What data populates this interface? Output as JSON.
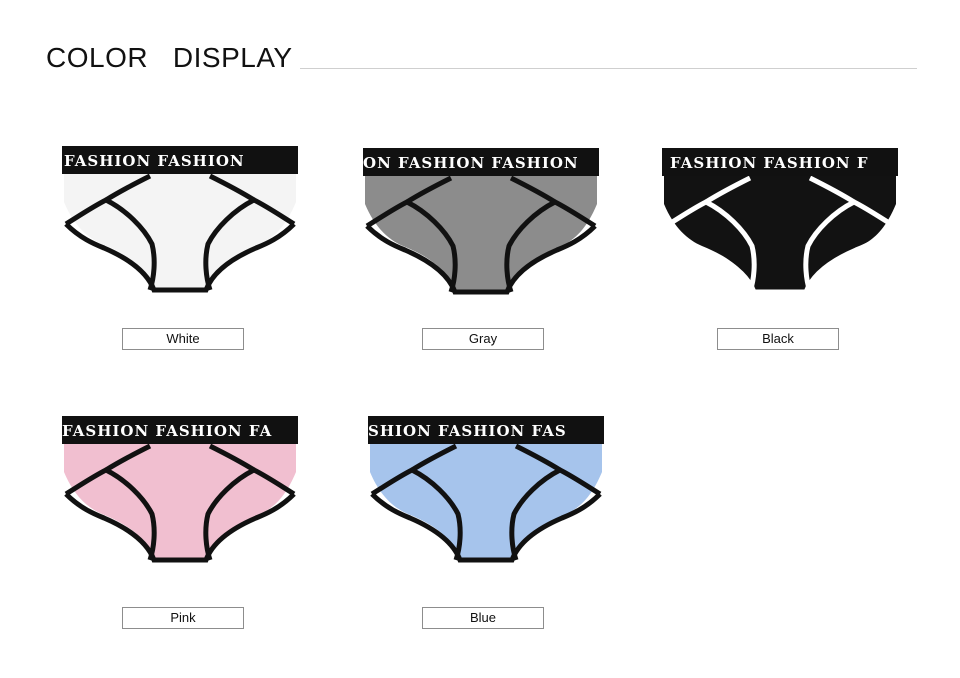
{
  "header": {
    "title": "COLOR   DISPLAY"
  },
  "products": [
    {
      "label": "White",
      "body_color": "#f4f4f4",
      "trim_color": "#111111",
      "band_color": "#111111",
      "band_text_color": "#ffffff",
      "band_text": "FASHION FASHION"
    },
    {
      "label": "Gray",
      "body_color": "#8c8c8c",
      "trim_color": "#111111",
      "band_color": "#111111",
      "band_text_color": "#ffffff",
      "band_text": "ON FASHION FASHION"
    },
    {
      "label": "Black",
      "body_color": "#121212",
      "trim_color": "#ffffff",
      "band_color": "#111111",
      "band_text_color": "#ffffff",
      "band_text": "FASHION FASHION F"
    },
    {
      "label": "Pink",
      "body_color": "#f1bfd0",
      "trim_color": "#111111",
      "band_color": "#111111",
      "band_text_color": "#ffffff",
      "band_text": "FASHION FASHION FA"
    },
    {
      "label": "Blue",
      "body_color": "#a6c4ec",
      "trim_color": "#111111",
      "band_color": "#111111",
      "band_text_color": "#ffffff",
      "band_text": "SHION FASHION FAS"
    }
  ]
}
